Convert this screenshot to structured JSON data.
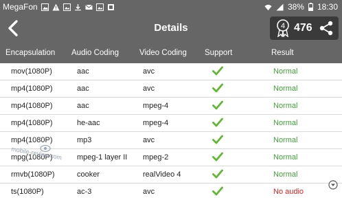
{
  "status_bar": {
    "carrier": "MegaFon",
    "battery": "38%",
    "time": "18:30"
  },
  "header": {
    "title": "Details",
    "score": "476"
  },
  "table": {
    "columns": [
      "Encapsulation",
      "Audio Coding",
      "Video Coding",
      "Support",
      "Result"
    ],
    "rows": [
      {
        "encapsulation": "mov(1080P)",
        "audio": "aac",
        "video": "avc",
        "support": "check",
        "result": "Normal"
      },
      {
        "encapsulation": "mp4(1080P)",
        "audio": "aac",
        "video": "avc",
        "support": "check",
        "result": "Normal"
      },
      {
        "encapsulation": "mp4(1080P)",
        "audio": "aac",
        "video": "mpeg-4",
        "support": "check",
        "result": "Normal"
      },
      {
        "encapsulation": "mp4(1080P)",
        "audio": "he-aac",
        "video": "mpeg-4",
        "support": "check",
        "result": "Normal"
      },
      {
        "encapsulation": "mp4(1080P)",
        "audio": "mp3",
        "video": "avc",
        "support": "check",
        "result": "Normal"
      },
      {
        "encapsulation": "mpg(1080P)",
        "audio": "mpeg-1 layer II",
        "video": "mpeg-2",
        "support": "check",
        "result": "Normal"
      },
      {
        "encapsulation": "rmvb(1080P)",
        "audio": "cooker",
        "video": "realVideo 4",
        "support": "check",
        "result": "Normal"
      },
      {
        "encapsulation": "ts(1080P)",
        "audio": "ac-3",
        "video": "avc",
        "support": "check",
        "result": "No audio"
      }
    ]
  },
  "watermark": "mobile-review.com",
  "colors": {
    "bar": "#666666",
    "check": "#5fb830",
    "normal": "#3ea235",
    "error": "#e02020"
  }
}
